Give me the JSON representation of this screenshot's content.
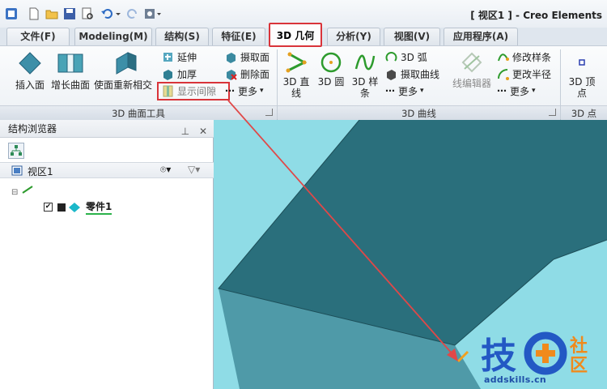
{
  "window": {
    "title": "[ 视区1 ] - Creo Elements"
  },
  "tabs": [
    {
      "label": "文件(F)"
    },
    {
      "label": "Modeling(M)"
    },
    {
      "label": "结构(S)"
    },
    {
      "label": "特征(E)"
    },
    {
      "label": "3D 几何",
      "active": true
    },
    {
      "label": "分析(Y)"
    },
    {
      "label": "视图(V)"
    },
    {
      "label": "应用程序(A)"
    }
  ],
  "ribbon": {
    "surface_tools": {
      "group_label": "3D 曲面工具",
      "insert_face": "插入面",
      "grow_surface": "增长曲面",
      "make_faces_tangent": "使面重新相交",
      "extend": "延伸",
      "thicken": "加厚",
      "show_gaps": "显示间隙",
      "extract_face": "摄取面",
      "delete_face": "删除面",
      "more": "更多"
    },
    "curves": {
      "group_label": "3D 曲线",
      "line_3d": "3D 直线",
      "circle_3d": "3D 圆",
      "spline_3d": "3D 样条",
      "arc_3d": "3D 弧",
      "extract_curve": "摄取曲线",
      "more": "更多",
      "wire_editor": "线编辑器",
      "modify_spline": "修改样条",
      "change_radius": "更改半径",
      "more2": "更多"
    },
    "points": {
      "group_label": "3D 点",
      "vertex": "3D 顶点"
    }
  },
  "browser": {
    "title": "结构浏览器",
    "view_name": "视区1",
    "part_name": "零件1"
  },
  "watermark": {
    "text_main": "技",
    "text_sub1": "社",
    "text_sub2": "区",
    "url": "addskills.cn"
  },
  "colors": {
    "highlight_red": "#d9343a",
    "body_dark": "#2a6f7c",
    "body_side": "#4f9aa8",
    "viewport_bg": "#8fdce6",
    "arrow_red": "#e04848"
  }
}
